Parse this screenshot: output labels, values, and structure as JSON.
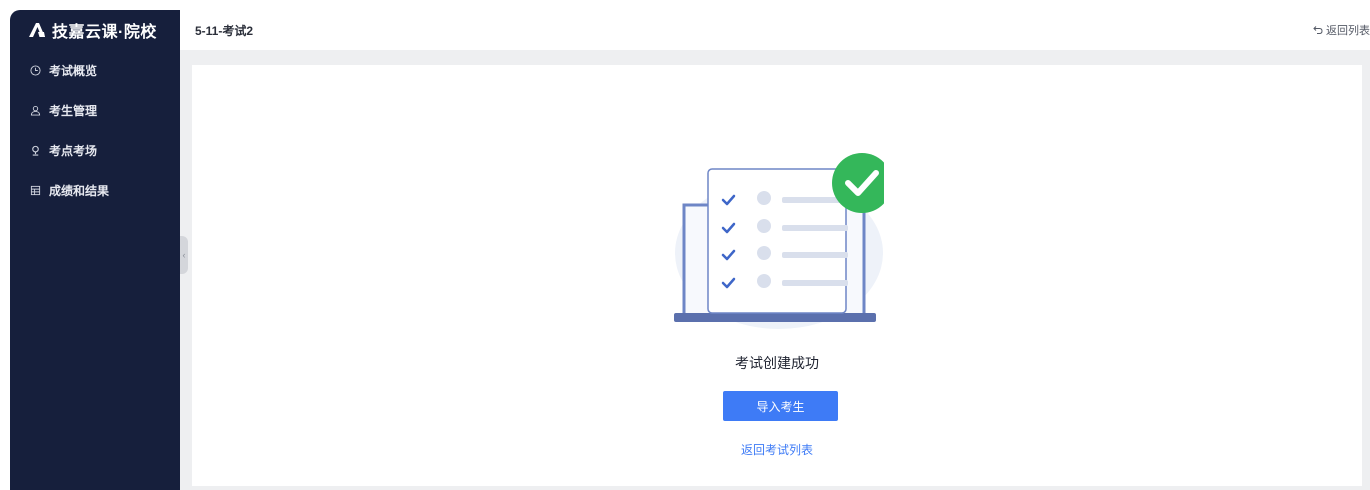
{
  "app": {
    "logo_text": "技嘉云课·院校"
  },
  "sidebar": {
    "items": [
      {
        "label": "考试概览",
        "icon": "clock-icon"
      },
      {
        "label": "考生管理",
        "icon": "user-icon"
      },
      {
        "label": "考点考场",
        "icon": "location-pin-icon"
      },
      {
        "label": "成绩和结果",
        "icon": "table-icon"
      }
    ]
  },
  "header": {
    "title": "5-11-考试2",
    "back_label": "返回列表"
  },
  "main": {
    "success_message": "考试创建成功",
    "primary_button": "导入考生",
    "back_to_list": "返回考试列表"
  },
  "colors": {
    "sidebar_bg": "#161f3c",
    "accent": "#3e7bf6",
    "success": "#34b75a"
  }
}
